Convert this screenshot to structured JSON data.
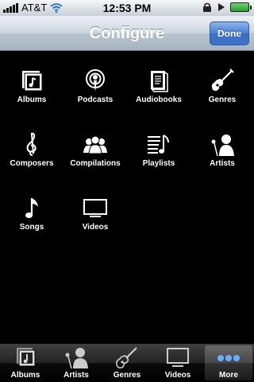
{
  "status_bar": {
    "carrier": "AT&T",
    "time": "12:53 PM"
  },
  "nav": {
    "title": "Configure",
    "done_label": "Done"
  },
  "grid": [
    {
      "label": "Albums",
      "icon": "albums-icon"
    },
    {
      "label": "Podcasts",
      "icon": "podcasts-icon"
    },
    {
      "label": "Audiobooks",
      "icon": "audiobooks-icon"
    },
    {
      "label": "Genres",
      "icon": "genres-icon"
    },
    {
      "label": "Composers",
      "icon": "composers-icon"
    },
    {
      "label": "Compilations",
      "icon": "compilations-icon"
    },
    {
      "label": "Playlists",
      "icon": "playlists-icon"
    },
    {
      "label": "Artists",
      "icon": "artists-icon"
    },
    {
      "label": "Songs",
      "icon": "songs-icon"
    },
    {
      "label": "Videos",
      "icon": "videos-icon"
    }
  ],
  "tabs": [
    {
      "label": "Albums",
      "icon": "albums-icon"
    },
    {
      "label": "Artists",
      "icon": "artists-icon"
    },
    {
      "label": "Genres",
      "icon": "genres-icon"
    },
    {
      "label": "Videos",
      "icon": "videos-icon"
    },
    {
      "label": "More",
      "icon": "more-icon",
      "selected": true
    }
  ]
}
